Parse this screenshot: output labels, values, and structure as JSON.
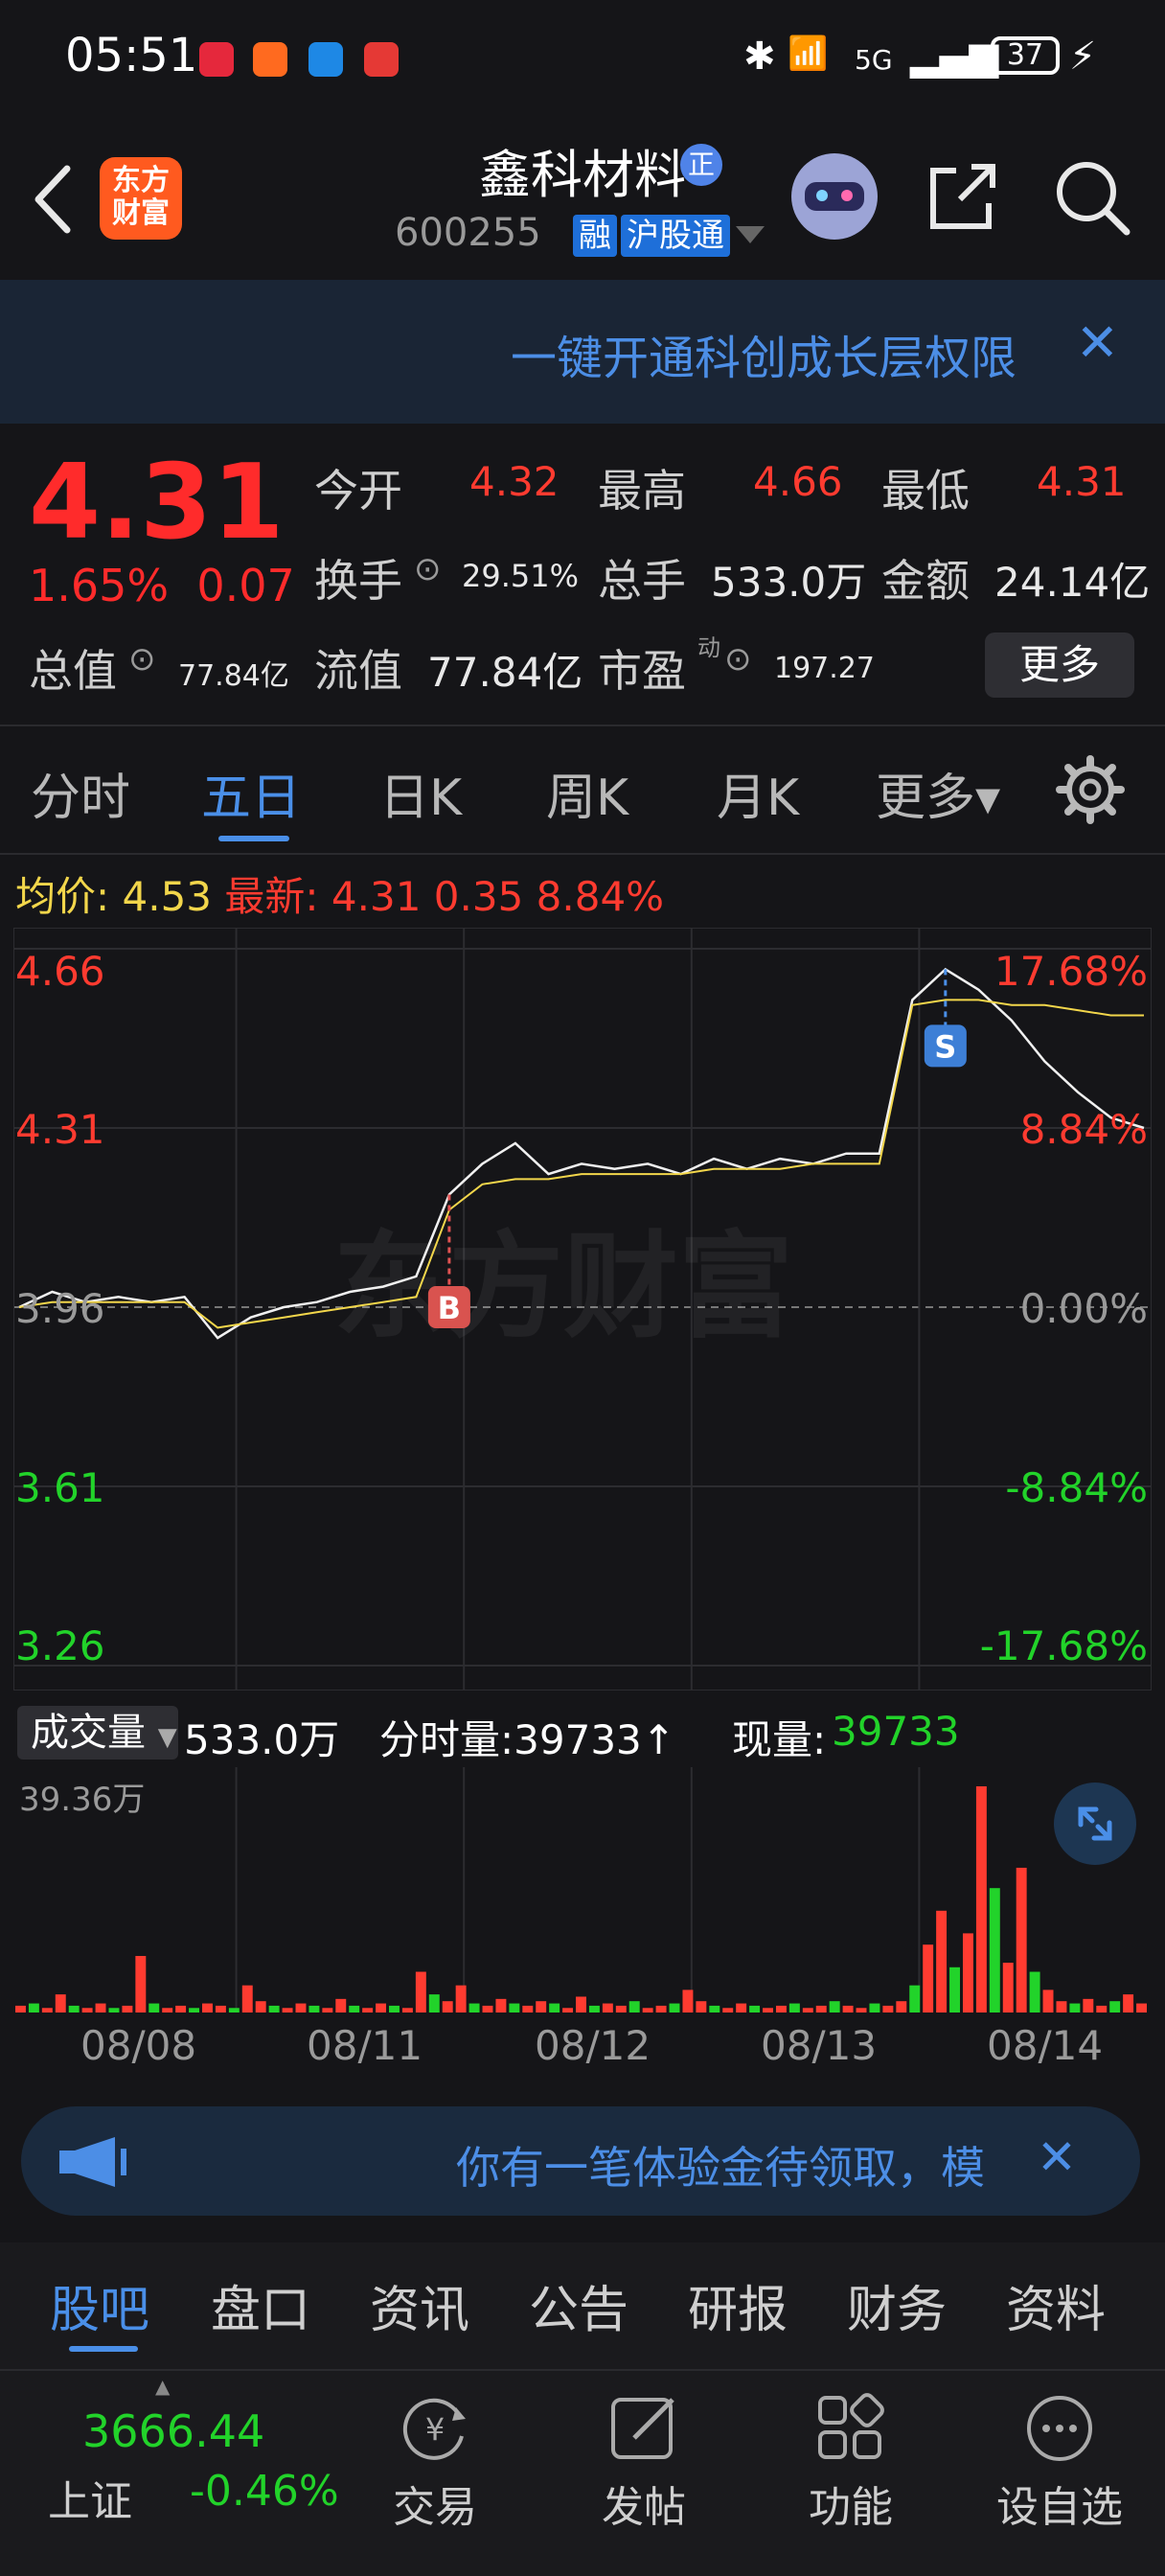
{
  "status_bar": {
    "time": "05:51",
    "network": "5G",
    "battery": "37"
  },
  "header": {
    "back_icon": "chevron-left-icon",
    "app_logo": "东方财富",
    "stock_name": "鑫科材料",
    "verified_badge": "正",
    "stock_code": "600255",
    "tag_margin": "融",
    "tag_connect": "沪股通",
    "share_icon": "share-icon",
    "search_icon": "search-icon"
  },
  "banner": {
    "text": "一键开通科创成长层权限",
    "close": "✕"
  },
  "quote": {
    "price": "4.31",
    "change_pct": "1.65%",
    "change_amt": "0.07",
    "open_label": "今开",
    "open": "4.32",
    "high_label": "最高",
    "high": "4.66",
    "low_label": "最低",
    "low": "4.31",
    "turnover_label": "换手",
    "turnover": "29.51%",
    "volume_label": "总手",
    "volume": "533.0万",
    "amount_label": "金额",
    "amount": "24.14亿",
    "mktcap_label": "总值",
    "mktcap": "77.84亿",
    "float_label": "流值",
    "float": "77.84亿",
    "pe_label": "市盈",
    "pe_sup": "动",
    "pe": "197.27",
    "more_button": "更多"
  },
  "period_tabs": [
    "分时",
    "五日",
    "日K",
    "周K",
    "月K",
    "更多▾"
  ],
  "chart_info": {
    "avg_label": "均价:",
    "avg_value": "4.53",
    "latest_label": "最新:",
    "latest_price": "4.31",
    "latest_change": "0.35",
    "latest_pct": "8.84%"
  },
  "chart_data": {
    "type": "line",
    "title": "",
    "y_left_ticks": [
      "4.66",
      "4.31",
      "3.96",
      "3.61",
      "3.26"
    ],
    "y_right_ticks": [
      "17.68%",
      "8.84%",
      "0.00%",
      "-8.84%",
      "-17.68%"
    ],
    "ylim": [
      3.26,
      4.66
    ],
    "x_categories": [
      "08/08",
      "08/11",
      "08/12",
      "08/13",
      "08/14"
    ],
    "series": [
      {
        "values": [
          3.96,
          3.99,
          3.97,
          3.98,
          3.97,
          3.98,
          3.9,
          3.94,
          3.96,
          3.97,
          3.99,
          4.0,
          4.02,
          4.18,
          4.24,
          4.28,
          4.22,
          4.24,
          4.23,
          4.24,
          4.22,
          4.25,
          4.23,
          4.25,
          4.24,
          4.26,
          4.26,
          4.56,
          4.62,
          4.58,
          4.52,
          4.44,
          4.38,
          4.33,
          4.31
        ]
      },
      {
        "values": [
          3.96,
          3.97,
          3.97,
          3.97,
          3.97,
          3.97,
          3.92,
          3.93,
          3.94,
          3.95,
          3.96,
          3.97,
          3.98,
          4.15,
          4.2,
          4.21,
          4.21,
          4.22,
          4.22,
          4.22,
          4.22,
          4.23,
          4.23,
          4.23,
          4.24,
          4.24,
          4.24,
          4.55,
          4.56,
          4.56,
          4.55,
          4.55,
          4.54,
          4.53,
          4.53
        ]
      }
    ],
    "markers": [
      {
        "label": "B",
        "x_index": 13,
        "price": 4.18
      },
      {
        "label": "S",
        "x_index": 28,
        "price": 4.62
      }
    ],
    "reference_line": 3.96,
    "watermark": "东方财富"
  },
  "volume": {
    "selector": "成交量",
    "total": "533.0万",
    "tick_label": "分时量:39733↑",
    "current_label": "现量:",
    "current_value": "39733",
    "max_label": "39.36万",
    "bars": [
      0.03,
      0.04,
      0.02,
      0.08,
      0.03,
      0.02,
      0.04,
      0.02,
      0.03,
      0.25,
      0.04,
      0.02,
      0.03,
      0.02,
      0.04,
      0.03,
      0.02,
      0.12,
      0.05,
      0.03,
      0.02,
      0.04,
      0.03,
      0.02,
      0.06,
      0.03,
      0.02,
      0.04,
      0.03,
      0.02,
      0.18,
      0.08,
      0.05,
      0.12,
      0.04,
      0.03,
      0.06,
      0.04,
      0.03,
      0.05,
      0.04,
      0.02,
      0.07,
      0.03,
      0.04,
      0.03,
      0.05,
      0.02,
      0.03,
      0.04,
      0.1,
      0.05,
      0.03,
      0.02,
      0.04,
      0.03,
      0.02,
      0.03,
      0.04,
      0.02,
      0.03,
      0.05,
      0.03,
      0.02,
      0.04,
      0.03,
      0.05,
      0.12,
      0.3,
      0.45,
      0.2,
      0.35,
      1.0,
      0.55,
      0.22,
      0.64,
      0.18,
      0.1,
      0.05,
      0.04,
      0.06,
      0.03,
      0.05,
      0.08,
      0.04
    ]
  },
  "expand_icon": "expand-icon",
  "promo": {
    "icon": "megaphone-icon",
    "text": "你有一笔体验金待领取，模",
    "close": "✕"
  },
  "bottom_tabs": [
    "股吧",
    "盘口",
    "资讯",
    "公告",
    "研报",
    "财务",
    "资料"
  ],
  "bottom_nav": {
    "index_value": "3666.44",
    "index_name": "上证",
    "index_change": "-0.46%",
    "items": [
      "交易",
      "发帖",
      "功能",
      "设自选"
    ]
  },
  "colors": {
    "up": "#ff3b30",
    "down": "#22d32a",
    "accent": "#4a8fe8",
    "avg_line": "#f2d64b"
  }
}
